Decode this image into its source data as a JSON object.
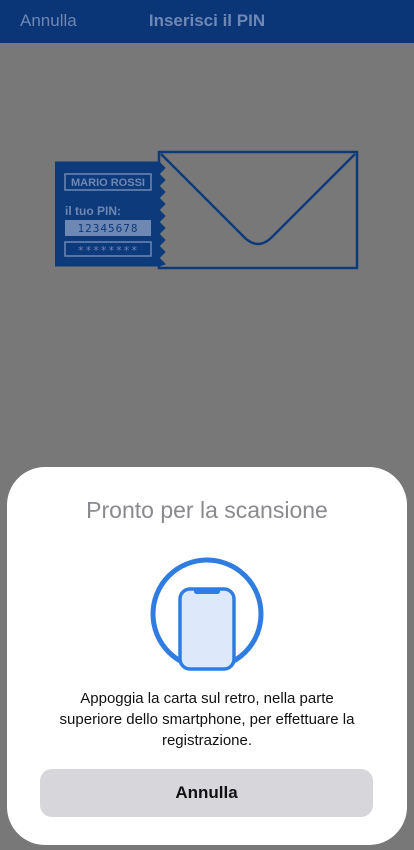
{
  "nav": {
    "cancel_label": "Annulla",
    "title": "Inserisci il PIN"
  },
  "illustration": {
    "name_label": "MARIO ROSSI",
    "pin_label": "il tuo PIN:",
    "pin_value": "12345678",
    "masked_value": "********"
  },
  "sheet": {
    "title": "Pronto per la scansione",
    "instruction_lines": [
      "Appoggia la carta sul retro, nella parte",
      "superiore dello smartphone, per effettuare la",
      "registrazione."
    ],
    "cancel_label": "Annulla"
  },
  "colors": {
    "navbar": "#0a3577",
    "illustration_dimmed_blue": "#0c3a7a",
    "scan_accent": "#2f7de1",
    "phone_fill": "#dde9fb",
    "overlay": "#787878",
    "button_bg": "#d6d6db"
  },
  "icons": {
    "scan": "phone-scan-icon",
    "envelope": "envelope-icon"
  }
}
